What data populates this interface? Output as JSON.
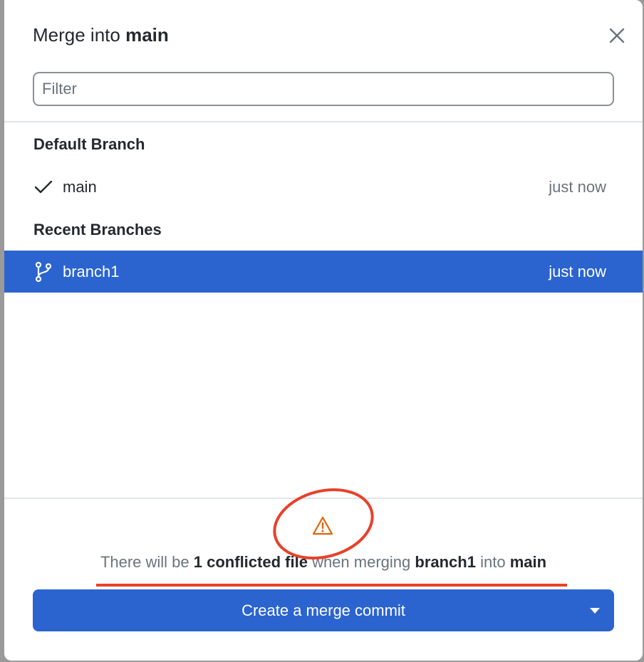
{
  "dialog": {
    "title_prefix": "Merge into",
    "title_branch": "main",
    "close_icon": "close-icon"
  },
  "filter": {
    "placeholder": "Filter",
    "value": ""
  },
  "sections": {
    "default_label": "Default Branch",
    "recent_label": "Recent Branches"
  },
  "branches": [
    {
      "name": "main",
      "time": "just now",
      "icon": "check-icon",
      "selected": false
    },
    {
      "name": "branch1",
      "time": "just now",
      "icon": "git-branch-icon",
      "selected": true
    }
  ],
  "footer": {
    "warning_icon": "warning-icon",
    "msg_1": "There will be",
    "msg_count": "1 conflicted file",
    "msg_2": "when merging",
    "msg_branch": "branch1",
    "msg_3": "into",
    "msg_target": "main",
    "button_label": "Create a merge commit"
  },
  "colors": {
    "accent": "#2b64cf",
    "warning": "#e36209",
    "annotation": "#e8412a"
  }
}
